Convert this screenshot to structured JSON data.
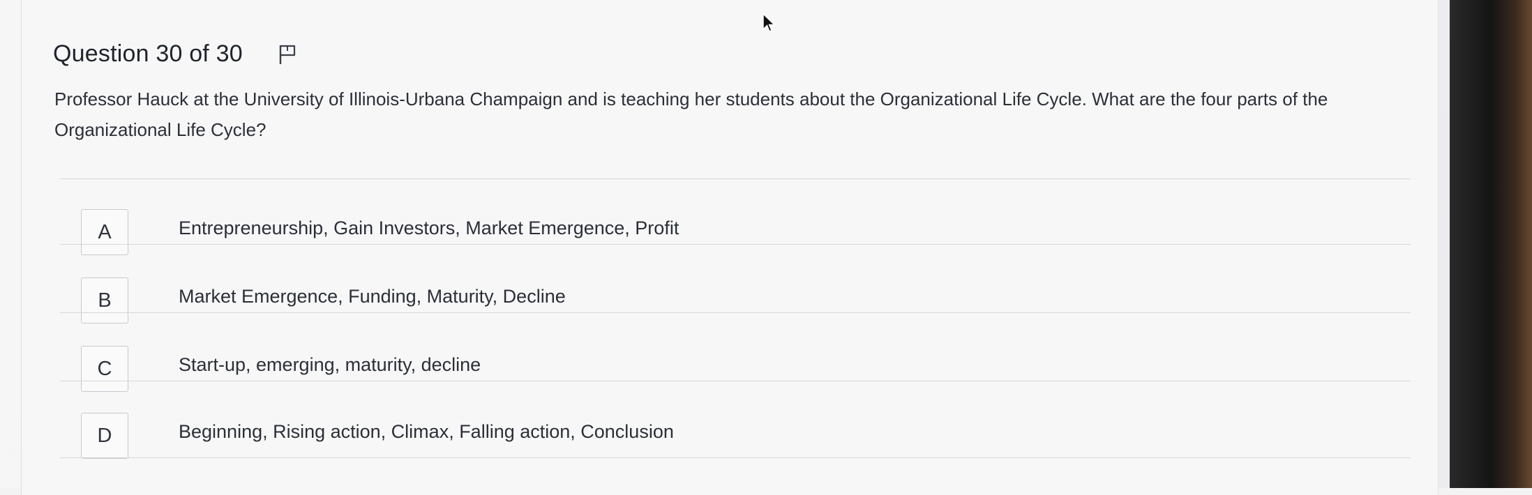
{
  "question": {
    "header": "Question 30 of 30",
    "text": "Professor Hauck at the University of Illinois-Urbana Champaign and is teaching her students about the Organizational Life Cycle. What are the four parts of the Organizational Life Cycle?",
    "flag_icon": "flag-icon"
  },
  "options": [
    {
      "letter": "A",
      "text": "Entrepreneurship, Gain Investors, Market Emergence, Profit"
    },
    {
      "letter": "B",
      "text": "Market Emergence, Funding, Maturity, Decline"
    },
    {
      "letter": "C",
      "text": "Start-up, emerging, maturity, decline"
    },
    {
      "letter": "D",
      "text": "Beginning, Rising action, Climax, Falling action, Conclusion"
    }
  ],
  "colors": {
    "background": "#f7f7f8",
    "text": "#2b2f36",
    "border": "#c8c9cd"
  }
}
